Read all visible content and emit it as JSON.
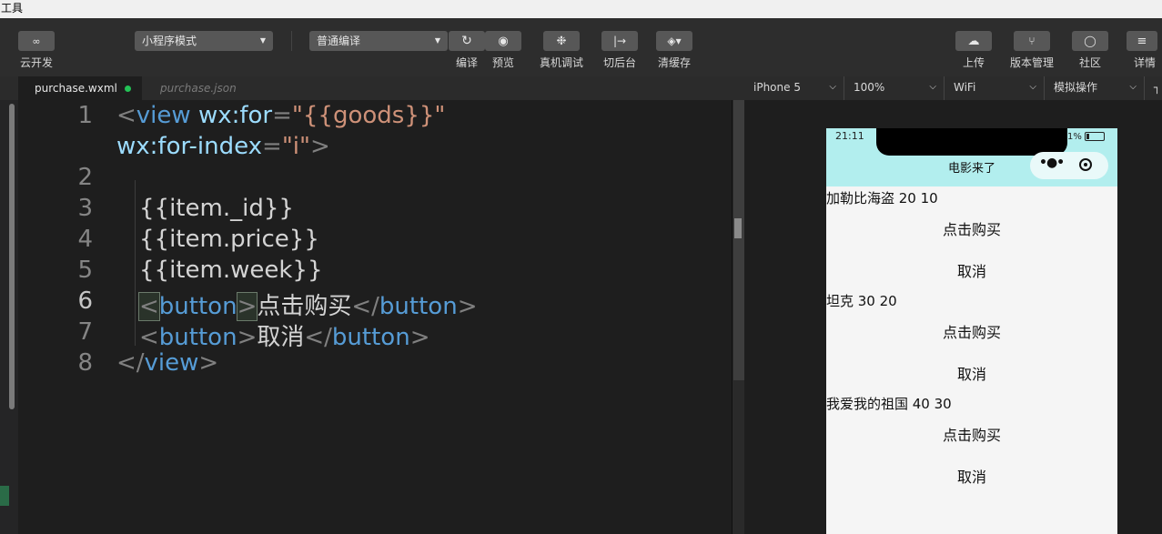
{
  "menubar": {
    "label": "工具"
  },
  "toolbar": {
    "cloud": {
      "label": "云开发"
    },
    "mode_select": "小程序模式",
    "compile_select": "普通编译",
    "compile_label": "编译",
    "preview_label": "预览",
    "remote_debug_label": "真机调试",
    "background_label": "切后台",
    "clear_cache_label": "清缓存",
    "upload_label": "上传",
    "version_label": "版本管理",
    "community_label": "社区",
    "details_label": "详情"
  },
  "tabs": [
    {
      "label": "purchase.wxml",
      "active": true
    },
    {
      "label": "purchase.json",
      "active": false
    }
  ],
  "simulator": {
    "device": "iPhone 5",
    "zoom": "100%",
    "network": "WiFi",
    "ops": "模拟操作",
    "phone": {
      "time": "21:11",
      "battery": "1%",
      "title": "电影来了",
      "items": [
        {
          "line": "加勒比海盗 20 10",
          "buy": "点击购买",
          "cancel": "取消"
        },
        {
          "line": "坦克 30 20",
          "buy": "点击购买",
          "cancel": "取消"
        },
        {
          "line": "我爱我的祖国 40 30",
          "buy": "点击购买",
          "cancel": "取消"
        }
      ]
    }
  },
  "editor": {
    "line_numbers": [
      "1",
      "2",
      "3",
      "4",
      "5",
      "6",
      "7",
      "8"
    ],
    "l1_tag_open": "<",
    "l1_tag": "view",
    "l1_attr1": "wx:for",
    "l1_eq1": "=",
    "l1_val1": "\"{{goods}}\"",
    "l1b_attr2": "wx:for-index",
    "l1b_eq2": "=",
    "l1b_val2": "\"i\"",
    "l1b_close": ">",
    "l3": "{{item._id}}",
    "l4": "{{item.price}}",
    "l5": "{{item.week}}",
    "l6_open": "<",
    "l6_tag": "button",
    "l6_gt": ">",
    "l6_text": "点击购买",
    "l6_close_open": "</",
    "l6_close_tag": "button",
    "l6_close_gt": ">",
    "l7_open": "<",
    "l7_tag": "button",
    "l7_gt": ">",
    "l7_text": "取消",
    "l7_close_open": "</",
    "l7_close_tag": "button",
    "l7_close_gt": ">",
    "l8_open": "</",
    "l8_tag": "view",
    "l8_gt": ">"
  }
}
